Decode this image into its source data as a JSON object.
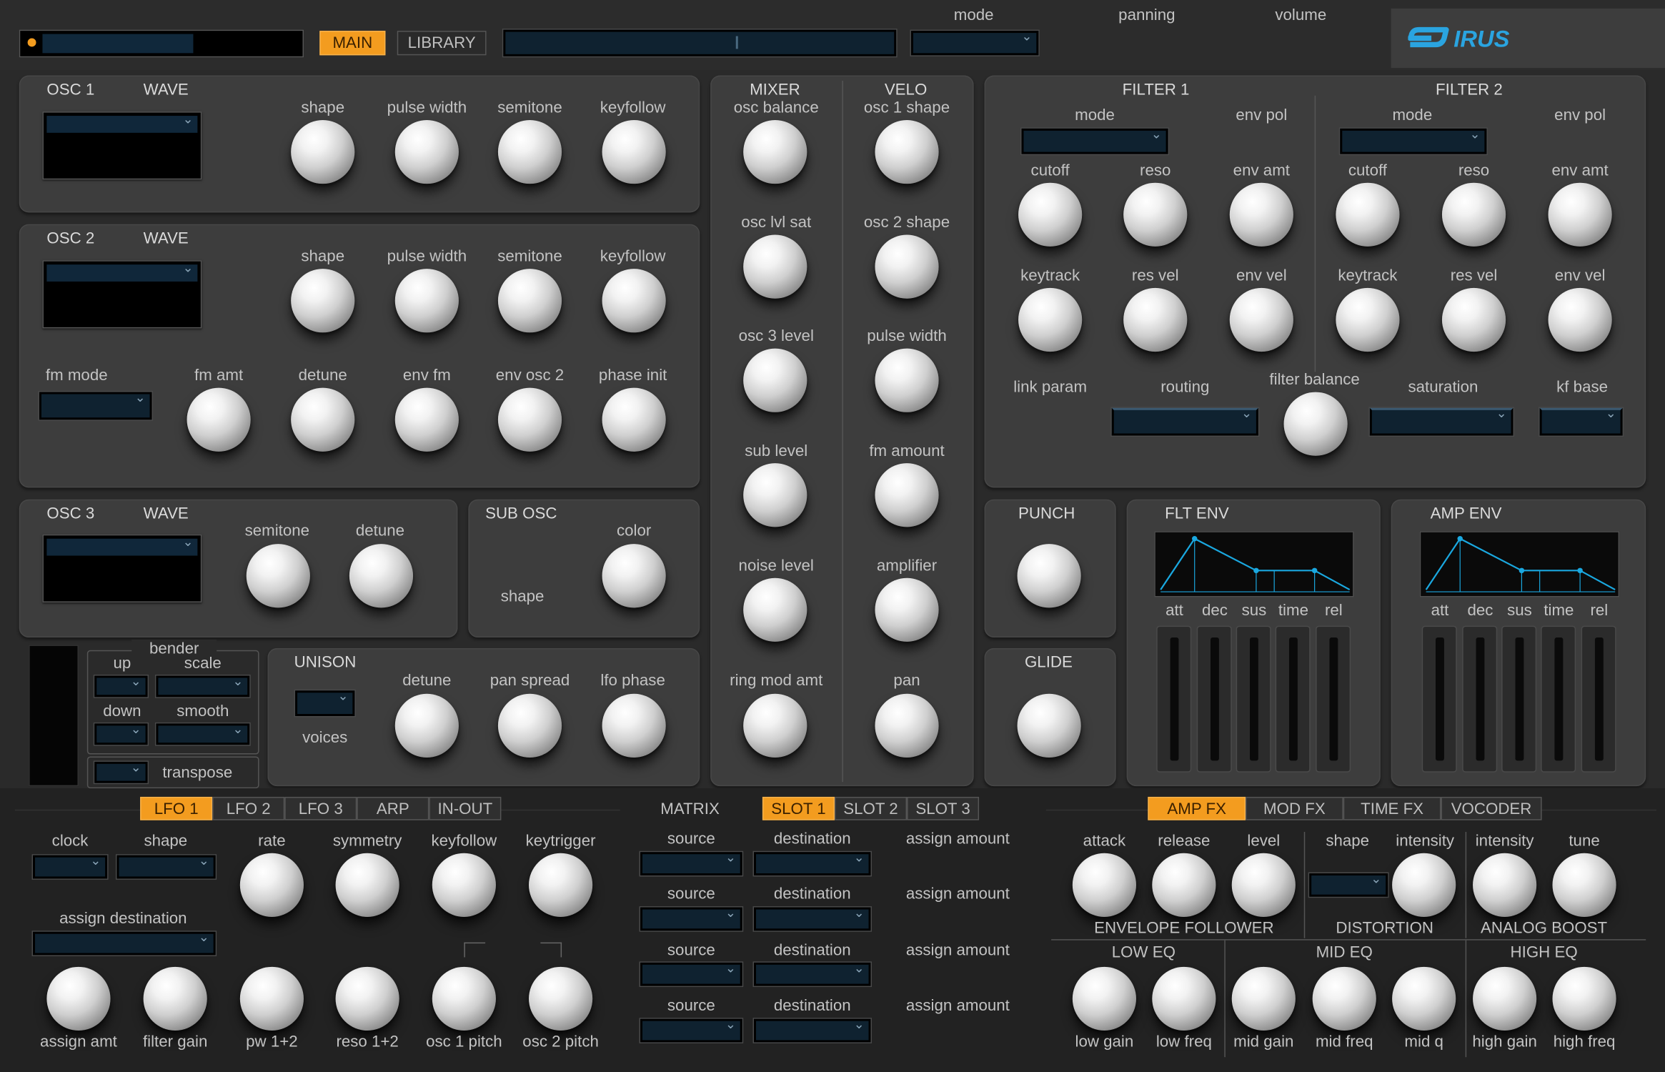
{
  "top_bar": {
    "main_tab": "MAIN",
    "library_tab": "LIBRARY",
    "mode_label": "mode",
    "panning_label": "panning",
    "volume_label": "volume",
    "logo_text": "IRUS"
  },
  "osc1": {
    "title": "OSC 1",
    "wave": "WAVE",
    "shape": "shape",
    "pulse_width": "pulse width",
    "semitone": "semitone",
    "keyfollow": "keyfollow"
  },
  "osc2": {
    "title": "OSC 2",
    "wave": "WAVE",
    "shape": "shape",
    "pulse_width": "pulse width",
    "semitone": "semitone",
    "keyfollow": "keyfollow",
    "fm_mode": "fm mode",
    "fm_amt": "fm amt",
    "detune": "detune",
    "env_fm": "env fm",
    "env_osc2": "env osc 2",
    "phase_init": "phase init"
  },
  "osc3": {
    "title": "OSC 3",
    "wave": "WAVE",
    "semitone": "semitone",
    "detune": "detune"
  },
  "sub_osc": {
    "title": "SUB OSC",
    "color": "color",
    "shape": "shape"
  },
  "bender": {
    "title": "bender",
    "up": "up",
    "scale": "scale",
    "down": "down",
    "smooth": "smooth",
    "transpose": "transpose"
  },
  "unison": {
    "title": "UNISON",
    "voices": "voices",
    "detune": "detune",
    "pan_spread": "pan spread",
    "lfo_phase": "lfo phase"
  },
  "mixer": {
    "title": "MIXER",
    "osc_balance": "osc balance",
    "osc_lvl_sat": "osc lvl sat",
    "osc3_level": "osc 3 level",
    "sub_level": "sub level",
    "noise_level": "noise level",
    "ring_mod_amt": "ring mod amt"
  },
  "velo": {
    "title": "VELO",
    "osc1_shape": "osc 1 shape",
    "osc2_shape": "osc 2 shape",
    "pulse_width": "pulse width",
    "fm_amount": "fm amount",
    "amplifier": "amplifier",
    "pan": "pan"
  },
  "filter1": {
    "title": "FILTER 1",
    "mode": "mode",
    "env_pol": "env pol",
    "cutoff": "cutoff",
    "reso": "reso",
    "env_amt": "env amt",
    "keytrack": "keytrack",
    "res_vel": "res vel",
    "env_vel": "env vel"
  },
  "filter2": {
    "title": "FILTER 2",
    "mode": "mode",
    "env_pol": "env pol",
    "cutoff": "cutoff",
    "reso": "reso",
    "env_amt": "env amt",
    "keytrack": "keytrack",
    "res_vel": "res vel",
    "env_vel": "env vel"
  },
  "filter_common": {
    "link_param": "link param",
    "routing": "routing",
    "filter_balance": "filter balance",
    "saturation": "saturation",
    "kf_base": "kf base"
  },
  "punch": {
    "title": "PUNCH"
  },
  "glide": {
    "title": "GLIDE"
  },
  "flt_env": {
    "title": "FLT ENV",
    "att": "att",
    "dec": "dec",
    "sus": "sus",
    "time": "time",
    "rel": "rel"
  },
  "amp_env": {
    "title": "AMP ENV",
    "att": "att",
    "dec": "dec",
    "sus": "sus",
    "time": "time",
    "rel": "rel"
  },
  "lfo": {
    "tabs": [
      "LFO 1",
      "LFO 2",
      "LFO 3",
      "ARP",
      "IN-OUT"
    ],
    "clock": "clock",
    "shape": "shape",
    "rate": "rate",
    "symmetry": "symmetry",
    "keyfollow": "keyfollow",
    "keytrigger": "keytrigger",
    "assign_destination": "assign destination",
    "assign_amt": "assign amt",
    "filter_gain": "filter gain",
    "pw12": "pw 1+2",
    "reso12": "reso 1+2",
    "osc1_pitch": "osc 1 pitch",
    "osc2_pitch": "osc 2 pitch"
  },
  "matrix": {
    "title": "MATRIX",
    "tabs": [
      "SLOT 1",
      "SLOT 2",
      "SLOT 3"
    ],
    "source": "source",
    "destination": "destination",
    "assign_amount": "assign  amount"
  },
  "fx": {
    "tabs": [
      "AMP FX",
      "MOD FX",
      "TIME FX",
      "VOCODER"
    ],
    "attack": "attack",
    "release": "release",
    "level": "level",
    "envelope_follower": "ENVELOPE FOLLOWER",
    "shape": "shape",
    "intensity": "intensity",
    "distortion": "DISTORTION",
    "boost_intensity": "intensity",
    "tune": "tune",
    "analog_boost": "ANALOG BOOST",
    "low_eq": "LOW EQ",
    "low_gain": "low gain",
    "low_freq": "low freq",
    "mid_eq": "MID EQ",
    "mid_gain": "mid gain",
    "mid_freq": "mid freq",
    "mid_q": "mid q",
    "high_eq": "HIGH EQ",
    "high_gain": "high gain",
    "high_freq": "high freq"
  },
  "colors": {
    "accent": "#f39c1f",
    "lcd": "#0f2230",
    "env_line": "#1aa8e0"
  }
}
